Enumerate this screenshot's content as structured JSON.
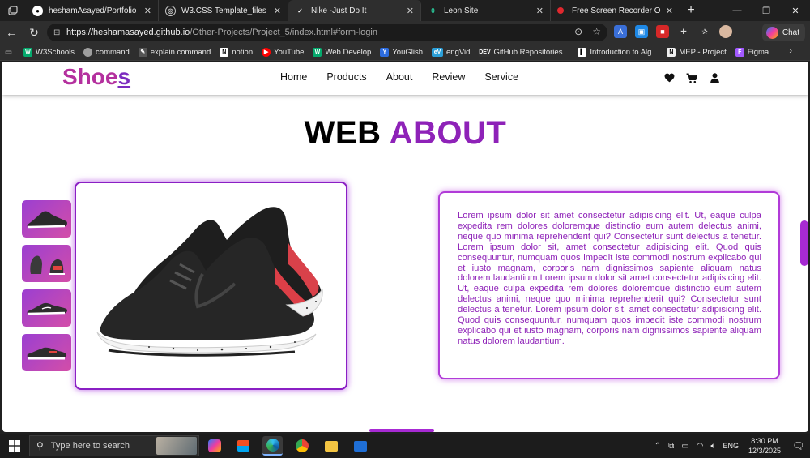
{
  "browser": {
    "tabs": [
      {
        "title": "heshamAsayed/Portfolio",
        "active": false,
        "icon": "github-icon"
      },
      {
        "title": "W3.CSS Template_files",
        "active": false,
        "icon": "globe-icon"
      },
      {
        "title": "Nike -Just Do It",
        "active": true,
        "icon": "nike-swoosh-icon"
      },
      {
        "title": "Leon Site",
        "active": false,
        "icon": "leon-site-icon"
      },
      {
        "title": "Free Screen Recorder Online",
        "active": false,
        "icon": "record-icon"
      }
    ],
    "new_tab_label": "+",
    "url_host": "https://heshamasayed.github.io",
    "url_path": "/Other-Projects/Project_5/index.html#form-login",
    "chat_label": "Chat",
    "bookmarks": [
      {
        "label": "W3Schools",
        "color": "#04aa6d"
      },
      {
        "label": "command",
        "color": "#9e9e9e"
      },
      {
        "label": "explain command",
        "color": "#555555"
      },
      {
        "label": "notion",
        "color": "#ffffff"
      },
      {
        "label": "YouTube",
        "color": "#ff0000"
      },
      {
        "label": "Web Develop",
        "color": "#04aa6d"
      },
      {
        "label": "YouGlish",
        "color": "#2d6cdf"
      },
      {
        "label": "engVid",
        "color": "#2b9fd8"
      },
      {
        "label": "GitHub Repositories...",
        "color": "#333333"
      },
      {
        "label": "Introduction to Alg...",
        "color": "#222222"
      },
      {
        "label": "MEP - Project",
        "color": "#eeeeee"
      },
      {
        "label": "Figma",
        "color": "#a259ff"
      }
    ]
  },
  "site": {
    "logo_main": "Shoe",
    "logo_last": "s",
    "nav": [
      "Home",
      "Products",
      "About",
      "Review",
      "Service"
    ],
    "header_icons": [
      "heart-icon",
      "cart-icon",
      "user-icon"
    ],
    "title_plain": "WEB",
    "title_accent": "ABOUT",
    "about_text": "Lorem ipsum dolor sit amet consectetur adipisicing elit. Ut, eaque culpa expedita rem dolores doloremque distinctio eum autem delectus animi, neque quo minima reprehenderit qui? Consectetur sunt delectus a tenetur. Lorem ipsum dolor sit, amet consectetur adipisicing elit. Quod quis consequuntur, numquam quos impedit iste commodi nostrum explicabo qui et iusto magnam, corporis nam dignissimos sapiente aliquam natus dolorem laudantium.Lorem ipsum dolor sit amet consectetur adipisicing elit. Ut, eaque culpa expedita rem dolores doloremque distinctio eum autem delectus animi, neque quo minima reprehenderit qui? Consectetur sunt delectus a tenetur. Lorem ipsum dolor sit, amet consectetur adipisicing elit. Quod quis consequuntur, numquam quos impedit iste commodi nostrum explicabo qui et iusto magnam, corporis nam dignissimos sapiente aliquam natus dolorem laudantium.",
    "accent_color": "#8e22b8",
    "logo_color": "#b4309e"
  },
  "taskbar": {
    "search_placeholder": "Type here to search",
    "lang": "ENG",
    "time": "8:30 PM",
    "date": "12/3/2025"
  }
}
